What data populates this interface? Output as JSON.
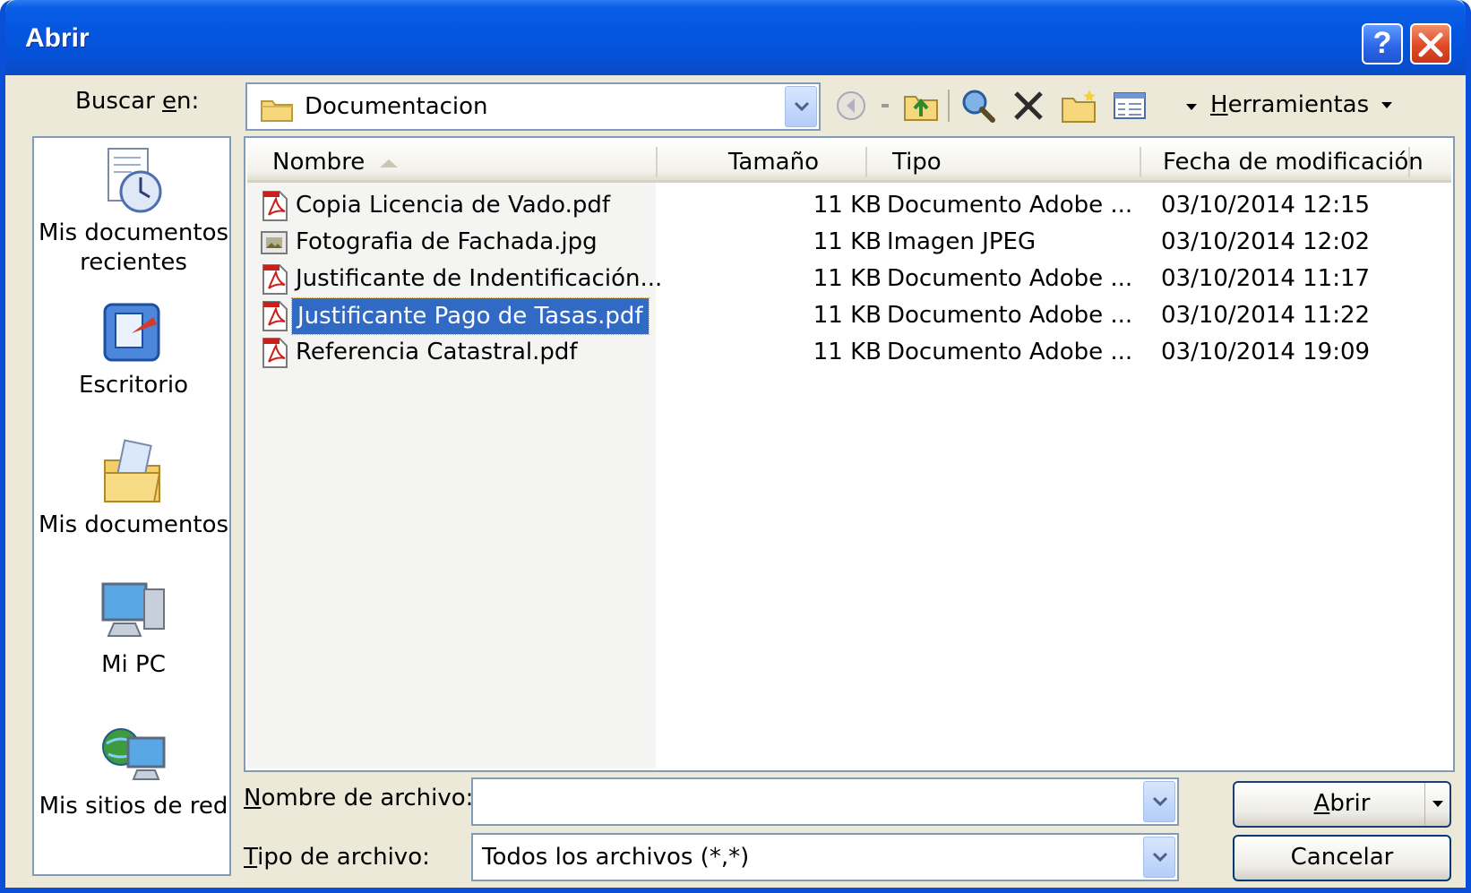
{
  "window": {
    "title": "Abrir",
    "help": "?",
    "close": "✕"
  },
  "lookin": {
    "label_pre": "Buscar ",
    "label_u": "e",
    "label_post": "n:",
    "value": "Documentacion"
  },
  "toolbar": {
    "tools_u": "H",
    "tools_rest": "erramientas"
  },
  "places": [
    {
      "label1": "Mis documentos",
      "label2": "recientes"
    },
    {
      "label1": "Escritorio"
    },
    {
      "label1": "Mis documentos"
    },
    {
      "label1": "Mi PC"
    },
    {
      "label1": "Mis sitios de red"
    }
  ],
  "columns": {
    "name": "Nombre",
    "size": "Tamaño",
    "type": "Tipo",
    "date": "Fecha de modificación"
  },
  "files": [
    {
      "name": "Copia Licencia de Vado.pdf",
      "size": "11 KB",
      "type": "Documento Adobe ...",
      "date": "03/10/2014 12:15",
      "icon": "pdf"
    },
    {
      "name": "Fotografia de Fachada.jpg",
      "size": "11 KB",
      "type": "Imagen JPEG",
      "date": "03/10/2014 12:02",
      "icon": "image"
    },
    {
      "name": "Justificante de Indentificación...",
      "size": "11 KB",
      "type": "Documento Adobe ...",
      "date": "03/10/2014 11:17",
      "icon": "pdf"
    },
    {
      "name": "Justificante Pago de Tasas.pdf",
      "size": "11 KB",
      "type": "Documento Adobe ...",
      "date": "03/10/2014 11:22",
      "icon": "pdf",
      "selected": true
    },
    {
      "name": "Referencia Catastral.pdf",
      "size": "11 KB",
      "type": "Documento Adobe ...",
      "date": "03/10/2014 19:09",
      "icon": "pdf"
    }
  ],
  "filename": {
    "label_u": "N",
    "label_rest": "ombre de archivo:",
    "value": ""
  },
  "filetype": {
    "label_u": "T",
    "label_rest": "ipo de archivo:",
    "value": "Todos los archivos (*,*)"
  },
  "buttons": {
    "open_u": "A",
    "open_rest": "brir",
    "cancel": "Cancelar"
  },
  "colors": {
    "title_bar": "#0556e0",
    "selection": "#316ac5",
    "face": "#ece9d8"
  }
}
